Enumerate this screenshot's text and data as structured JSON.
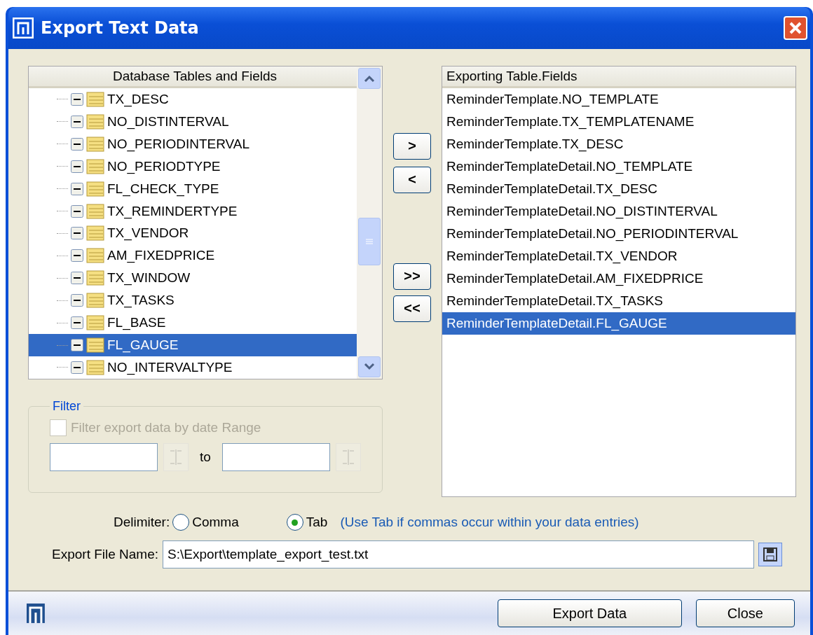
{
  "window": {
    "title": "Export Text Data"
  },
  "tree": {
    "header": "Database Tables and Fields",
    "items": [
      {
        "label": "TX_DESC",
        "selected": false
      },
      {
        "label": "NO_DISTINTERVAL",
        "selected": false
      },
      {
        "label": "NO_PERIODINTERVAL",
        "selected": false
      },
      {
        "label": "NO_PERIODTYPE",
        "selected": false
      },
      {
        "label": "FL_CHECK_TYPE",
        "selected": false
      },
      {
        "label": "TX_REMINDERTYPE",
        "selected": false
      },
      {
        "label": "TX_VENDOR",
        "selected": false
      },
      {
        "label": "AM_FIXEDPRICE",
        "selected": false
      },
      {
        "label": "TX_WINDOW",
        "selected": false
      },
      {
        "label": "TX_TASKS",
        "selected": false
      },
      {
        "label": "FL_BASE",
        "selected": false
      },
      {
        "label": "FL_GAUGE",
        "selected": true
      },
      {
        "label": "NO_INTERVALTYPE",
        "selected": false
      }
    ]
  },
  "move_buttons": [
    ">",
    "<",
    ">>",
    "<<"
  ],
  "export_list": {
    "header": "Exporting Table.Fields",
    "items": [
      {
        "label": "ReminderTemplate.NO_TEMPLATE",
        "selected": false
      },
      {
        "label": "ReminderTemplate.TX_TEMPLATENAME",
        "selected": false
      },
      {
        "label": "ReminderTemplate.TX_DESC",
        "selected": false
      },
      {
        "label": "ReminderTemplateDetail.NO_TEMPLATE",
        "selected": false
      },
      {
        "label": "ReminderTemplateDetail.TX_DESC",
        "selected": false
      },
      {
        "label": "ReminderTemplateDetail.NO_DISTINTERVAL",
        "selected": false
      },
      {
        "label": "ReminderTemplateDetail.NO_PERIODINTERVAL",
        "selected": false
      },
      {
        "label": "ReminderTemplateDetail.TX_VENDOR",
        "selected": false
      },
      {
        "label": "ReminderTemplateDetail.AM_FIXEDPRICE",
        "selected": false
      },
      {
        "label": "ReminderTemplateDetail.TX_TASKS",
        "selected": false
      },
      {
        "label": "ReminderTemplateDetail.FL_GAUGE",
        "selected": true
      }
    ]
  },
  "filter": {
    "title": "Filter",
    "disabled": true,
    "checkbox": {
      "label": "Filter export data by date Range",
      "checked": false
    },
    "to_label": "to"
  },
  "delimiter": {
    "label": "Delimiter:",
    "options": [
      {
        "label": "Comma",
        "selected": false
      },
      {
        "label": "Tab",
        "selected": true
      }
    ],
    "hint": "(Use Tab if commas occur within your data entries)"
  },
  "file_name": {
    "label": "Export File Name:",
    "value": "S:\\Export\\template_export_test.txt"
  },
  "buttons": [
    "Export Data",
    "Close"
  ]
}
